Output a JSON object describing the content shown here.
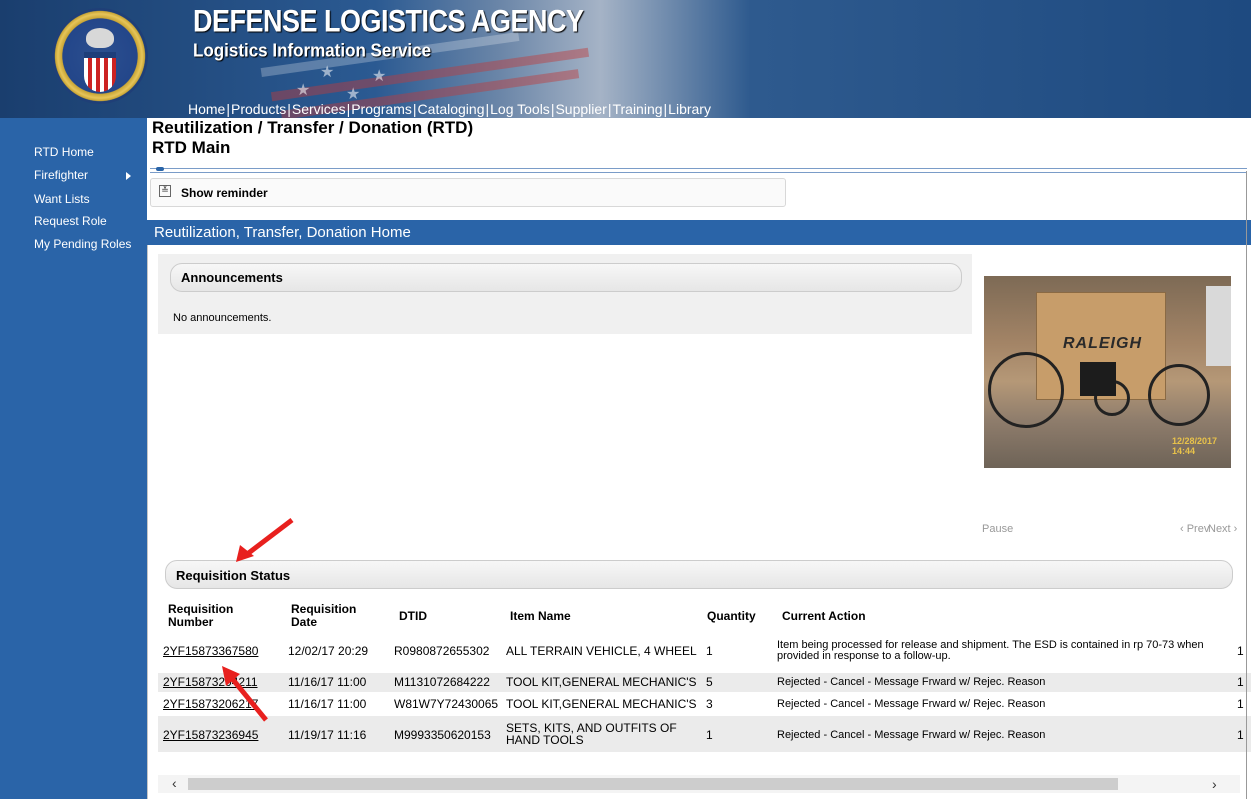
{
  "banner": {
    "agency": "DEFENSE LOGISTICS AGENCY",
    "service": "Logistics Information Service",
    "nav": [
      "Home",
      "Products",
      "Services",
      "Programs",
      "Cataloging",
      "Log Tools",
      "Supplier",
      "Training",
      "Library"
    ],
    "nav_separator": "|"
  },
  "sidebar": {
    "items": [
      {
        "label": "RTD Home"
      },
      {
        "label": "Firefighter"
      },
      {
        "label": "Want Lists"
      },
      {
        "label": "Request Role"
      },
      {
        "label": "My Pending Roles"
      }
    ],
    "background": "#2a64a8"
  },
  "header": {
    "title": "Reutilization / Transfer / Donation (RTD)",
    "subtitle": "RTD Main"
  },
  "reminder": {
    "label": "Show reminder",
    "icon": "chevron-double-down-icon"
  },
  "section": {
    "title": "Reutilization, Transfer, Donation Home"
  },
  "announcements": {
    "title": "Announcements",
    "text": "No announcements."
  },
  "photo": {
    "brand": "RALEIGH",
    "timestamp": "12/28/2017 14:44"
  },
  "carousel": {
    "pause": "Pause",
    "prev": "‹ Prev",
    "next": "Next ›"
  },
  "requisition": {
    "title": "Requisition Status",
    "columns": [
      "Requisition Number",
      "Requisition Date",
      "DTID",
      "Item Name",
      "Quantity",
      "Current Action"
    ],
    "rows": [
      {
        "number": "2YF15873367580",
        "date": "12/02/17 20:29",
        "dtid": "R0980872655302",
        "item": "ALL TERRAIN VEHICLE, 4 WHEEL",
        "qty": "1",
        "action": "Item being processed for release and shipment. The ESD is contained in rp 70-73 when provided in response to a follow-up.",
        "extra": "1"
      },
      {
        "number": "2YF15873204211",
        "date": "11/16/17 11:00",
        "dtid": "M1131072684222",
        "item": "TOOL KIT,GENERAL MECHANIC'S",
        "qty": "5",
        "action": "Rejected - Cancel - Message Frward w/ Rejec. Reason",
        "extra": "1"
      },
      {
        "number": "2YF15873206217",
        "date": "11/16/17 11:00",
        "dtid": "W81W7Y72430065",
        "item": "TOOL KIT,GENERAL MECHANIC'S",
        "qty": "3",
        "action": "Rejected - Cancel - Message Frward w/ Rejec. Reason",
        "extra": "1"
      },
      {
        "number": "2YF15873236945",
        "date": "11/19/17 11:16",
        "dtid": "M9993350620153",
        "item": "SETS, KITS, AND OUTFITS OF HAND TOOLS",
        "qty": "1",
        "action": "Rejected - Cancel - Message Frward w/ Rejec. Reason",
        "extra": "1"
      }
    ]
  },
  "scrollbar": {
    "left": "‹",
    "right": "›"
  },
  "colors": {
    "accent": "#2a64a8",
    "arrow": "#e8201e"
  }
}
